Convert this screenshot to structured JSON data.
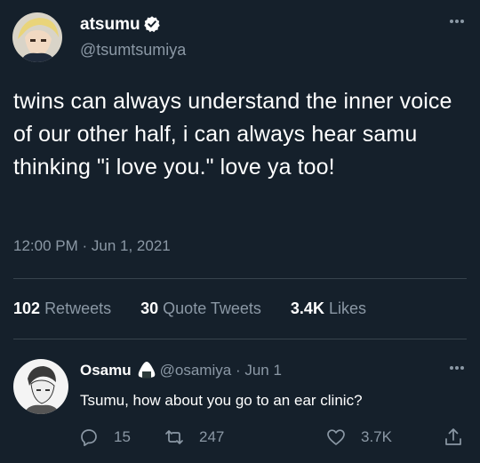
{
  "tweet": {
    "display_name": "atsumu",
    "handle": "@tsumtsumiya",
    "text": "twins can always understand the inner voice of our other half, i can always hear samu thinking \"i love you.\" love ya too!",
    "timestamp": "12:00 PM · Jun 1, 2021",
    "stats": {
      "retweets_count": "102",
      "retweets_label": "Retweets",
      "quotes_count": "30",
      "quotes_label": "Quote Tweets",
      "likes_count": "3.4K",
      "likes_label": "Likes"
    }
  },
  "reply": {
    "display_name": "Osamu",
    "handle": "@osamiya",
    "date": "· Jun 1",
    "text": "Tsumu, how about you go to an ear clinic?",
    "replies": "15",
    "retweets": "247",
    "likes": "3.7K"
  },
  "colors": {
    "background": "#15202b",
    "text": "#ffffff",
    "muted": "#8b98a5",
    "divider": "#38444d"
  },
  "icons": {
    "verified": "verified-badge-icon",
    "more": "more-options-icon",
    "onigiri": "onigiri-icon",
    "reply": "reply-icon",
    "retweet": "retweet-icon",
    "like": "heart-icon",
    "share": "share-icon"
  }
}
